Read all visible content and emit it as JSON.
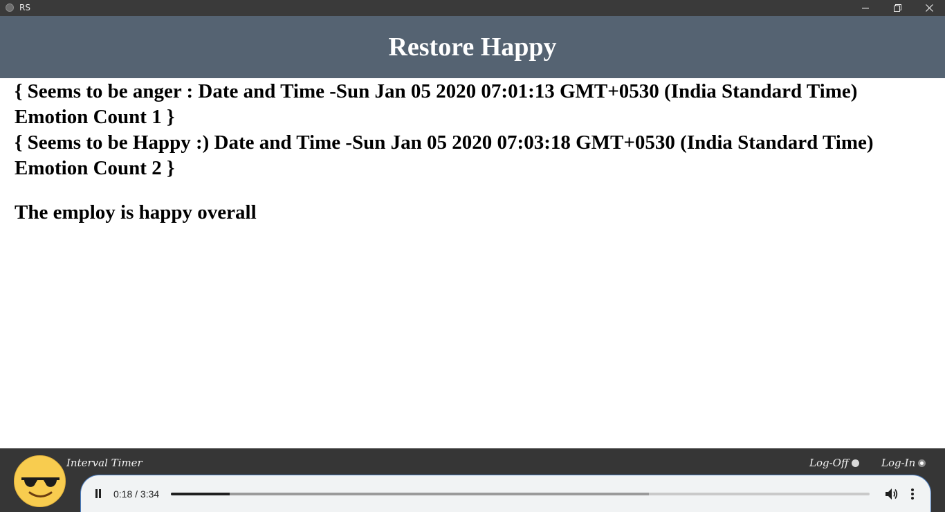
{
  "window": {
    "title": "RS"
  },
  "header": {
    "title": "Restore Happy"
  },
  "log": {
    "entries": [
      "{ Seems to be anger : Date and Time -Sun Jan 05 2020 07:01:13 GMT+0530 (India Standard Time) Emotion Count 1 }",
      "{ Seems to be Happy :) Date and Time -Sun Jan 05 2020 07:03:18 GMT+0530 (India Standard Time) Emotion Count 2 }"
    ],
    "summary": "The employ is happy overall"
  },
  "footer": {
    "timer_label": "Interval Timer",
    "logoff_label": "Log-Off",
    "login_label": "Log-In",
    "selected": "Log-In"
  },
  "player": {
    "time_display": "0:18 / 3:34",
    "played_fraction": 0.0841,
    "buffered_fraction": 0.684,
    "state": "playing"
  },
  "colors": {
    "header_bg": "#556372",
    "footer_bg": "#363636",
    "titlebar_bg": "#3a3a3a",
    "emoji_face": "#f8cc4f"
  },
  "icons": {
    "app": "app-icon",
    "minimize": "minimize-icon",
    "restore": "restore-icon",
    "close": "close-icon",
    "emoji": "sunglasses-emoji-icon",
    "pause": "pause-icon",
    "volume": "volume-icon",
    "menu": "more-vertical-icon"
  }
}
